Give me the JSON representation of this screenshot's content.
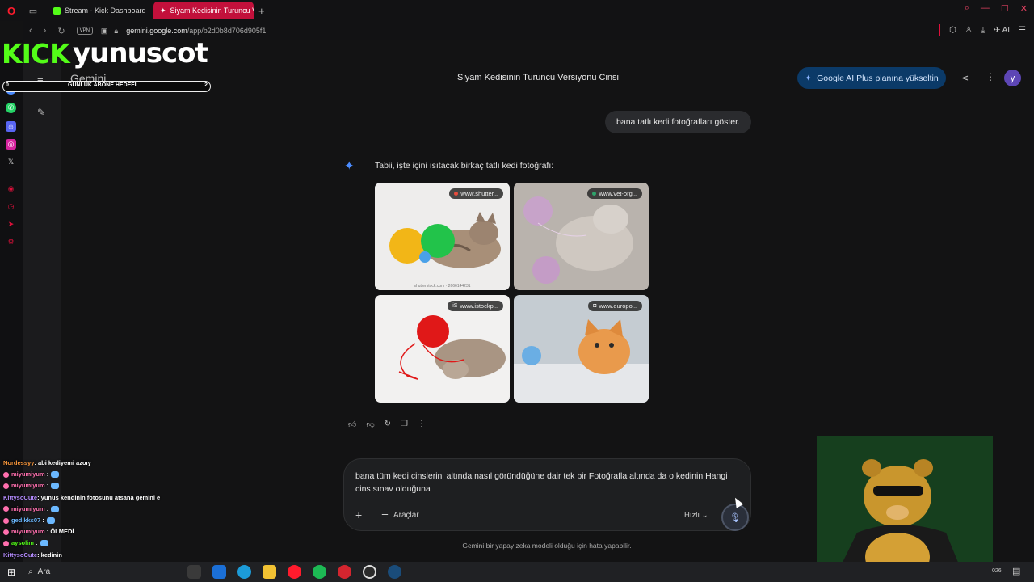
{
  "browser": {
    "tabs": [
      {
        "label": "Stream - Kick Dashboard",
        "favicon_color": "#53fc18"
      },
      {
        "label": "Siyam Kedisinin Turuncu V",
        "favicon_color": "#ffffff",
        "active": true
      }
    ],
    "vpn_label": "VPN",
    "url_host": "gemini.google.com",
    "url_path": "/app/b2d0b8d706d905f1",
    "ai_label": "AI"
  },
  "gemini": {
    "logo": "Gemini",
    "conversation_title": "Siyam Kedisinin Turuncu Versiyonu Cinsi",
    "upgrade_label": "Google AI Plus planına yükseltin",
    "avatar_letter": "y",
    "user_message": "bana tatlı kedi fotoğrafları göster.",
    "response_text": "Tabii, işte içini ısıtacak birkaç tatlı kedi fotoğrafı:",
    "images": [
      {
        "source": "www.shutter...",
        "caption": "shutterstock.com · 2666144231"
      },
      {
        "source": "www.vet-org..."
      },
      {
        "source": "www.istockp..."
      },
      {
        "source": "www.europo..."
      }
    ],
    "input_text": "bana tüm kedi cinslerini altında nasıl göründüğüne dair tek bir Fotoğrafla altında da o kedinin Hangi cins sınav olduğuna",
    "tools_label": "Araçlar",
    "mode_label": "Hızlı",
    "disclaimer": "Gemini bir yapay zeka modeli olduğu için hata yapabilir."
  },
  "stream": {
    "platform_logo": "KICK",
    "channel": "yunuscot",
    "goal_label": "GUNLUK ABONE HEDEFI",
    "goal_current": "0",
    "goal_target": "2",
    "chat": [
      {
        "user": "Nordessyy",
        "user_color": "#ff9a3c",
        "text": ": abi kediyemi azoıy",
        "badge": false,
        "emote": false
      },
      {
        "user": "miyumiyum",
        "user_color": "#ff6fae",
        "text": " :",
        "badge": true,
        "emote": true
      },
      {
        "user": "miyumiyum",
        "user_color": "#ff6fae",
        "text": " :",
        "badge": true,
        "emote": true
      },
      {
        "user": "KittysoCute",
        "user_color": "#b58cff",
        "text": ": yunus kendinin fotosunu atsana gemini e",
        "badge": false,
        "emote": false
      },
      {
        "user": "miyumiyum",
        "user_color": "#ff6fae",
        "text": " :",
        "badge": true,
        "emote": true
      },
      {
        "user": "gedikks07",
        "user_color": "#6bb8ff",
        "text": " :",
        "badge": true,
        "emote": true
      },
      {
        "user": "miyumiyum",
        "user_color": "#ff6fae",
        "text": " : ÖLMEDİ",
        "badge": true,
        "emote": false
      },
      {
        "user": "aysolim",
        "user_color": "#53fc18",
        "text": " :",
        "badge": true,
        "emote": true
      },
      {
        "user": "KittysoCute",
        "user_color": "#b58cff",
        "text": ": kedinin",
        "badge": false,
        "emote": false
      }
    ]
  },
  "taskbar": {
    "search_label": "Ara",
    "clock_fragment": "026"
  }
}
